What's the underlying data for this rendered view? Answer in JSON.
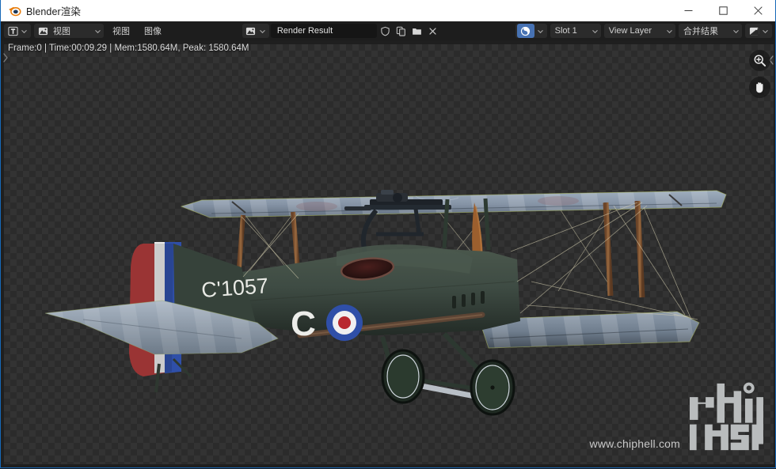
{
  "window": {
    "title": "Blender渲染",
    "logo_icon": "blender-logo-icon",
    "controls": {
      "minimize_label": "—",
      "minimize_icon": "minimize-icon",
      "maximize_label": "□",
      "maximize_icon": "maximize-icon",
      "close_label": "✕",
      "close_icon": "close-icon"
    },
    "accent_color": "#1668b8"
  },
  "header": {
    "editor_type": {
      "icon": "editor-type-image-icon",
      "dropdown_icon": "chevron-down-icon"
    },
    "display_mode": {
      "icon": "image-editor-icon",
      "label": "视图",
      "dropdown_icon": "chevron-down-icon"
    },
    "menus": [
      {
        "label": "视图",
        "name": "menu-view"
      },
      {
        "label": "图像",
        "name": "menu-image"
      }
    ],
    "image_block": {
      "browse_icon": "browse-image-icon",
      "browse_dropdown_icon": "chevron-down-icon",
      "datablock_name": "Render Result",
      "fake_user_icon": "shield-icon",
      "new_copy_icon": "duplicate-icon",
      "open_icon": "folder-icon",
      "unlink_icon": "close-x-icon"
    },
    "render_block": {
      "render_icon": "render-result-icon",
      "render_dropdown_icon": "chevron-down-icon",
      "slot": "Slot 1",
      "slot_dropdown_icon": "chevron-down-icon",
      "view_layer": "View Layer",
      "view_layer_dropdown_icon": "chevron-down-icon",
      "pass": "合并结果",
      "pass_dropdown_icon": "chevron-down-icon",
      "display_channels_icon": "display-channels-icon",
      "display_channels_dropdown_icon": "chevron-down-icon"
    },
    "colors": {
      "bar_bg": "#1d1d1d",
      "widget_bg": "#2b2b2b",
      "field_bg": "#151515",
      "highlight": "#4772b3"
    }
  },
  "render_info": {
    "text": "Frame:0 | Time:00:09.29 | Mem:1580.64M, Peak: 1580.64M",
    "frame": "0",
    "time": "00:09.29",
    "memory": "1580.64M",
    "peak": "1580.64M"
  },
  "canvas": {
    "sidebar_toggle_icon": "chevron-right-icon",
    "background": "transparent-checkerboard",
    "checker_colors": [
      "#2b2b2b",
      "#333333"
    ],
    "tools": [
      {
        "name": "zoom-tool",
        "icon": "magnifier-plus-icon"
      },
      {
        "name": "pan-tool",
        "icon": "hand-icon"
      }
    ],
    "region_chevron_icon": "chevron-left-icon"
  },
  "render_subject": {
    "description": "WWI biplane 3D render",
    "tail_number": "C'1057",
    "fuselage_letter": "C",
    "marking": "RAF roundel",
    "rudder_stripes": [
      "#b03c3c",
      "#e8e8e8",
      "#2f4fa8"
    ],
    "colors": {
      "fuselage": "#3d4a42",
      "wing": "#7f8d9e",
      "strut": "#8b5e3c",
      "roundel_outer": "#2f4fa8",
      "roundel_mid": "#f0f0f0",
      "roundel_inner": "#b8282e"
    }
  },
  "watermark": {
    "url": "www.chiphell.com",
    "logo_text": "chiphell",
    "logo_icon": "chiphell-logo-icon"
  }
}
